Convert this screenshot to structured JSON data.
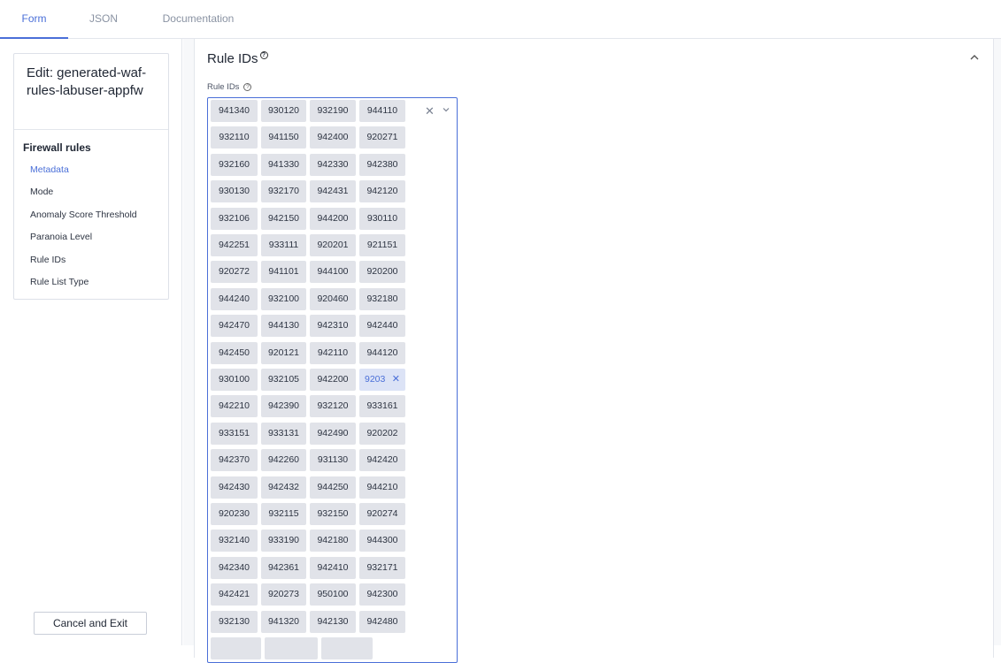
{
  "tabs": [
    "Form",
    "JSON",
    "Documentation"
  ],
  "nav": {
    "title": "Edit: generated-waf-rules-labuser-appfw",
    "group": "Firewall rules",
    "items": [
      "Metadata",
      "Mode",
      "Anomaly Score Threshold",
      "Paranoia Level",
      "Rule IDs",
      "Rule List Type"
    ],
    "cancel_label": "Cancel and Exit"
  },
  "section": {
    "title": "Rule IDs",
    "field_label": "Rule IDs",
    "help_icon": "question-circle-icon",
    "collapse_icon": "chevron-up-icon"
  },
  "rule_ids": {
    "rows": [
      [
        "941340",
        "930120",
        "932190",
        "944110"
      ],
      [
        "932110",
        "941150",
        "942400",
        "920271"
      ],
      [
        "932160",
        "941330",
        "942330",
        "942380"
      ],
      [
        "930130",
        "932170",
        "942431",
        "942120"
      ],
      [
        "932106",
        "942150",
        "944200",
        "930110"
      ],
      [
        "942251",
        "933111",
        "920201",
        "921151"
      ],
      [
        "920272",
        "941101",
        "944100",
        "920200"
      ],
      [
        "944240",
        "932100",
        "920460",
        "932180"
      ],
      [
        "942470",
        "944130",
        "942310",
        "942440"
      ],
      [
        "942450",
        "920121",
        "942110",
        "944120"
      ],
      [
        "930100",
        "932105",
        "942200",
        "9203"
      ],
      [
        "942210",
        "942390",
        "932120",
        "933161"
      ],
      [
        "933151",
        "933131",
        "942490",
        "920202"
      ],
      [
        "942370",
        "942260",
        "931130",
        "942420"
      ],
      [
        "942430",
        "942432",
        "944250",
        "944210"
      ],
      [
        "920230",
        "932115",
        "932150",
        "920274"
      ],
      [
        "932140",
        "933190",
        "942180",
        "944300"
      ],
      [
        "942340",
        "942361",
        "942410",
        "932171"
      ],
      [
        "942421",
        "920273",
        "950100",
        "942300"
      ],
      [
        "932130",
        "941320",
        "942130",
        "942480"
      ]
    ],
    "focused_row": 10,
    "focused_col": 3
  }
}
